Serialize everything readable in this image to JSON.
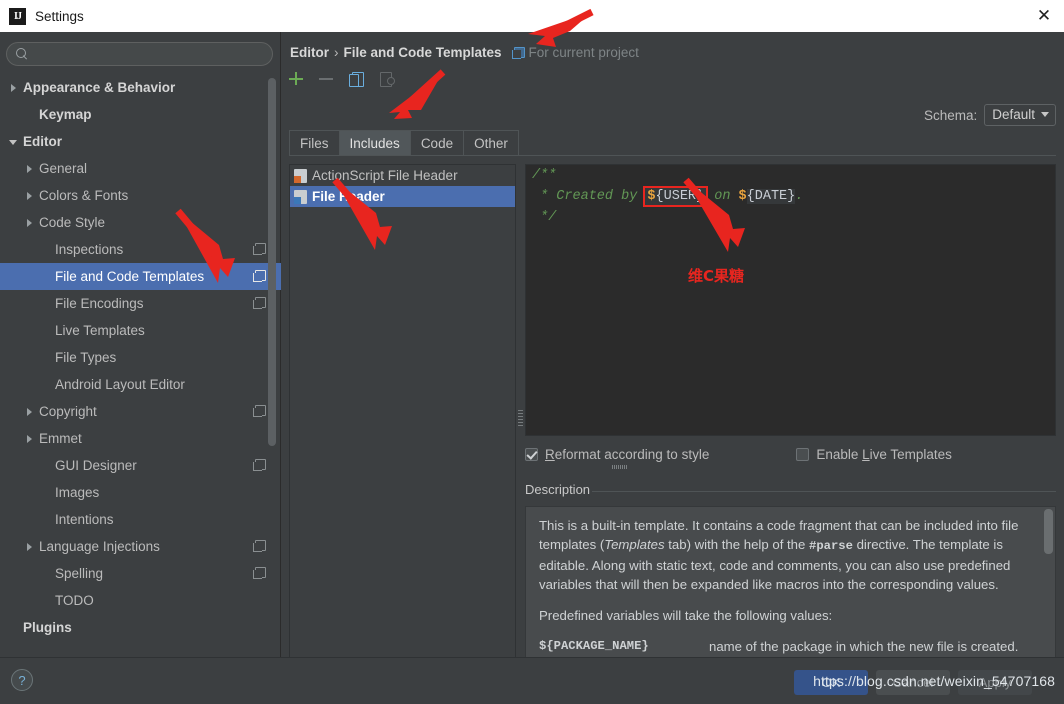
{
  "window": {
    "title": "Settings",
    "app_icon_label": "IJ",
    "close_label": "✕"
  },
  "sidebar": {
    "search": {
      "value": "",
      "placeholder": ""
    },
    "items": [
      {
        "label": "Appearance & Behavior",
        "indent": 0,
        "twisty": "right",
        "bold": true,
        "badge": false,
        "selected": false
      },
      {
        "label": "Keymap",
        "indent": 1,
        "twisty": "none",
        "bold": true,
        "badge": false,
        "selected": false
      },
      {
        "label": "Editor",
        "indent": 0,
        "twisty": "down",
        "bold": true,
        "badge": false,
        "selected": false
      },
      {
        "label": "General",
        "indent": 1,
        "twisty": "right",
        "bold": false,
        "badge": false,
        "selected": false
      },
      {
        "label": "Colors & Fonts",
        "indent": 1,
        "twisty": "right",
        "bold": false,
        "badge": false,
        "selected": false
      },
      {
        "label": "Code Style",
        "indent": 1,
        "twisty": "right",
        "bold": false,
        "badge": false,
        "selected": false
      },
      {
        "label": "Inspections",
        "indent": 2,
        "twisty": "none",
        "bold": false,
        "badge": true,
        "selected": false
      },
      {
        "label": "File and Code Templates",
        "indent": 2,
        "twisty": "none",
        "bold": false,
        "badge": true,
        "selected": true
      },
      {
        "label": "File Encodings",
        "indent": 2,
        "twisty": "none",
        "bold": false,
        "badge": true,
        "selected": false
      },
      {
        "label": "Live Templates",
        "indent": 2,
        "twisty": "none",
        "bold": false,
        "badge": false,
        "selected": false
      },
      {
        "label": "File Types",
        "indent": 2,
        "twisty": "none",
        "bold": false,
        "badge": false,
        "selected": false
      },
      {
        "label": "Android Layout Editor",
        "indent": 2,
        "twisty": "none",
        "bold": false,
        "badge": false,
        "selected": false
      },
      {
        "label": "Copyright",
        "indent": 1,
        "twisty": "right",
        "bold": false,
        "badge": true,
        "selected": false
      },
      {
        "label": "Emmet",
        "indent": 1,
        "twisty": "right",
        "bold": false,
        "badge": false,
        "selected": false
      },
      {
        "label": "GUI Designer",
        "indent": 2,
        "twisty": "none",
        "bold": false,
        "badge": true,
        "selected": false
      },
      {
        "label": "Images",
        "indent": 2,
        "twisty": "none",
        "bold": false,
        "badge": false,
        "selected": false
      },
      {
        "label": "Intentions",
        "indent": 2,
        "twisty": "none",
        "bold": false,
        "badge": false,
        "selected": false
      },
      {
        "label": "Language Injections",
        "indent": 1,
        "twisty": "right",
        "bold": false,
        "badge": true,
        "selected": false
      },
      {
        "label": "Spelling",
        "indent": 2,
        "twisty": "none",
        "bold": false,
        "badge": true,
        "selected": false
      },
      {
        "label": "TODO",
        "indent": 2,
        "twisty": "none",
        "bold": false,
        "badge": false,
        "selected": false
      },
      {
        "label": "Plugins",
        "indent": 0,
        "twisty": "none",
        "bold": true,
        "badge": false,
        "selected": false
      }
    ]
  },
  "header": {
    "breadcrumb_root": "Editor",
    "breadcrumb_sep": "›",
    "breadcrumb_leaf": "File and Code Templates",
    "scope_note": "For current project",
    "schema_label": "Schema:",
    "schema_value": "Default"
  },
  "toolbar": {
    "add_label": "+",
    "remove_label": "−",
    "copy_label": "copy-template",
    "create_from_file_label": "create-template-from-file"
  },
  "tabs": [
    {
      "label": "Files",
      "active": false
    },
    {
      "label": "Includes",
      "active": true
    },
    {
      "label": "Code",
      "active": false
    },
    {
      "label": "Other",
      "active": false
    }
  ],
  "template_list": [
    {
      "label": "ActionScript File Header",
      "icon": "as",
      "selected": false
    },
    {
      "label": "File Header",
      "icon": "jv",
      "selected": true
    }
  ],
  "editor": {
    "line1": "/**",
    "line2_prefix": " * Created by ",
    "line2_var1_dollar": "$",
    "line2_var1_name": "{USER}",
    "line2_mid": " on ",
    "line2_var2_dollar": "$",
    "line2_var2_name": "{DATE}",
    "line2_suffix": ".",
    "line3": " */"
  },
  "options": {
    "reformat": {
      "label_pre": "R",
      "label_rest": "eformat according to style",
      "checked": true
    },
    "live_templates": {
      "label_pre": "Enable ",
      "label_mnemonic": "L",
      "label_rest": "ive Templates",
      "checked": false
    }
  },
  "description": {
    "title": "Description",
    "para1_a": "This is a built-in template. It contains a code fragment that can be included into file templates (",
    "para1_italic": "Templates",
    "para1_b": " tab) with the help of the ",
    "para1_mono": "#parse",
    "para1_c": " directive. The template is editable. Along with static text, code and comments, you can also use predefined variables that will then be expanded like macros into the corresponding values.",
    "para2": "Predefined variables will take the following values:",
    "var_name": "${PACKAGE_NAME}",
    "var_desc": "name of the package in which the new file is created."
  },
  "footer": {
    "help_label": "?",
    "ok_label": "OK",
    "cancel_label": "Cancel",
    "apply_label": "Apply",
    "watermark": "https://blog.csdn.net/weixin_54707168"
  },
  "annotations": {
    "note_text": "维C果糖",
    "color": "#e8251f"
  }
}
